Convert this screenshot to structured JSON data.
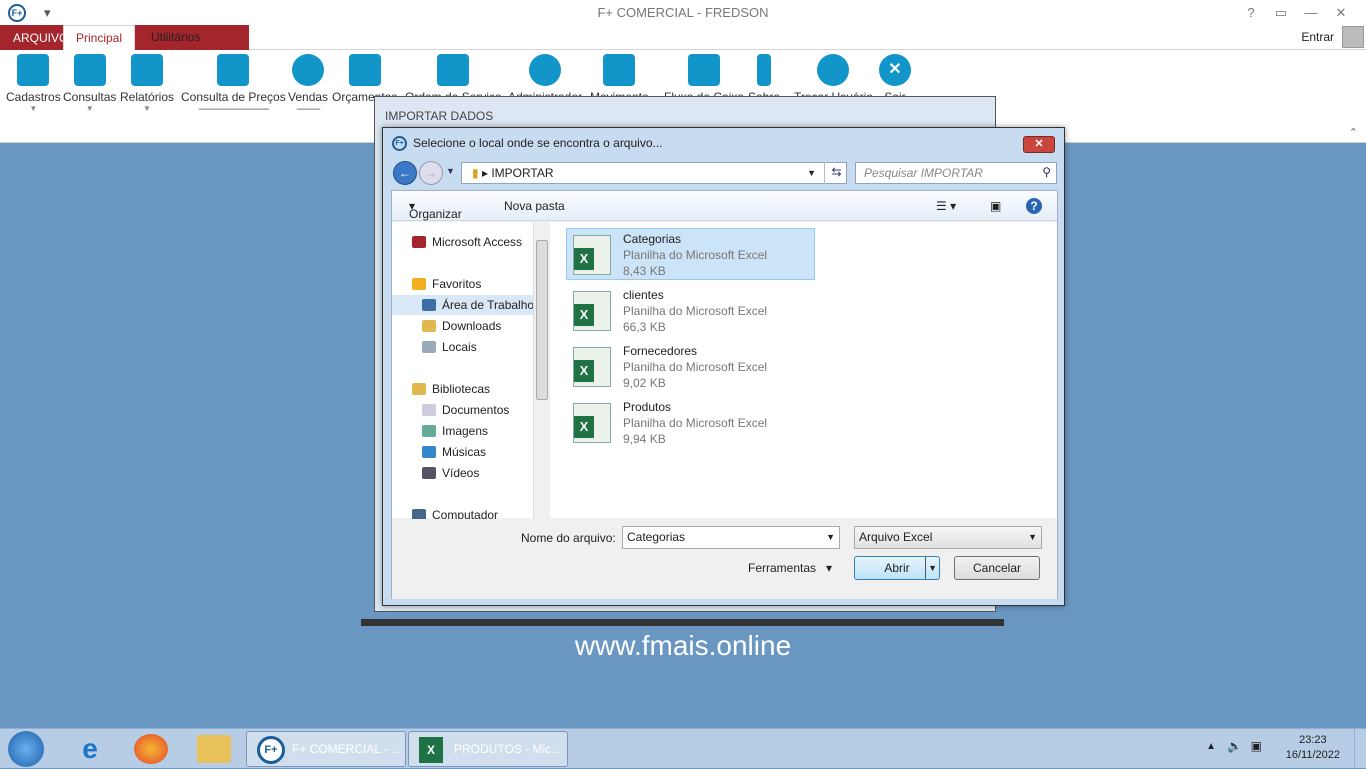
{
  "app": {
    "title": "F+ COMERCIAL - FREDSON",
    "logo": "F+",
    "help": "?",
    "user_label": "Entrar"
  },
  "tabs": [
    "ARQUIVO",
    "Principal",
    "Utilitários"
  ],
  "ribbon": [
    {
      "label": "Cadastros",
      "dropdown": true
    },
    {
      "label": "Consultas",
      "dropdown": true
    },
    {
      "label": "Relatórios",
      "dropdown": true
    },
    {
      "label": "Consulta de Preços"
    },
    {
      "label": "Vendas"
    },
    {
      "label": "Orçamentos"
    },
    {
      "label": "Ordem de Serviço"
    },
    {
      "label": "Administrador"
    },
    {
      "label": "Movimento"
    },
    {
      "label": "Fluxo de Caixa"
    },
    {
      "label": "Sobre"
    },
    {
      "label": "Trocar Usuário"
    },
    {
      "label": "Sair"
    }
  ],
  "background": {
    "url": "www.fmais.online",
    "import_window_title": "IMPORTAR DADOS"
  },
  "dialog": {
    "title": "Selecione o local onde se encontra o arquivo...",
    "path": "IMPORTAR",
    "search_placeholder": "Pesquisar IMPORTAR",
    "toolbar": {
      "organize": "Organizar",
      "new_folder": "Nova pasta"
    },
    "nav": [
      {
        "label": "Microsoft Access",
        "icon": "access-icon",
        "indent": false
      },
      {
        "label": "Favoritos",
        "icon": "star-icon",
        "indent": false
      },
      {
        "label": "Área de Trabalho",
        "icon": "desktop-icon",
        "indent": true,
        "selected": true
      },
      {
        "label": "Downloads",
        "icon": "downloads-folder-icon",
        "indent": true
      },
      {
        "label": "Locais",
        "icon": "recent-places-icon",
        "indent": true
      },
      {
        "label": "Bibliotecas",
        "icon": "libraries-icon",
        "indent": false
      },
      {
        "label": "Documentos",
        "icon": "documents-icon",
        "indent": true
      },
      {
        "label": "Imagens",
        "icon": "pictures-icon",
        "indent": true
      },
      {
        "label": "Músicas",
        "icon": "music-icon",
        "indent": true
      },
      {
        "label": "Vídeos",
        "icon": "videos-icon",
        "indent": true
      },
      {
        "label": "Computador",
        "icon": "computer-icon",
        "indent": false
      }
    ],
    "files": [
      {
        "name": "Categorias",
        "type": "Planilha do Microsoft Excel",
        "size": "8,43 KB",
        "selected": true
      },
      {
        "name": "clientes",
        "type": "Planilha do Microsoft Excel",
        "size": "66,3 KB"
      },
      {
        "name": "Fornecedores",
        "type": "Planilha do Microsoft Excel",
        "size": "9,02 KB"
      },
      {
        "name": "Produtos",
        "type": "Planilha do Microsoft Excel",
        "size": "9,94 KB"
      }
    ],
    "filename_label": "Nome do arquivo:",
    "filename_value": "Categorias",
    "filter": "Arquivo Excel",
    "tools": "Ferramentas",
    "open": "Abrir",
    "cancel": "Cancelar"
  },
  "taskbar": {
    "apps": [
      {
        "label": "F+ COMERCIAL - ..."
      },
      {
        "label": "PRODUTOS - Mic..."
      }
    ],
    "time": "23:23",
    "date": "16/11/2022"
  }
}
